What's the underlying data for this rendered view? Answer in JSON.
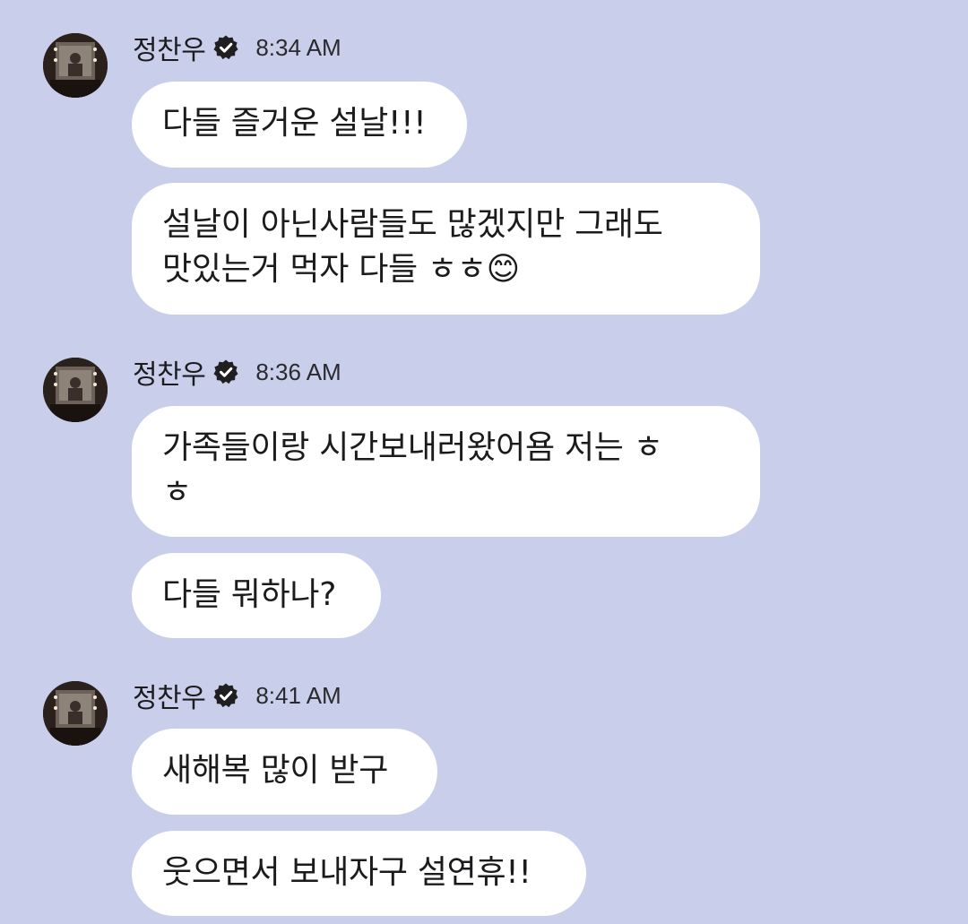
{
  "messages": [
    {
      "sender": "정찬우",
      "time": "8:34 AM",
      "bubbles": [
        "다들 즐거운 설날!!!",
        "설날이 아닌사람들도 많겠지만 그래도\n맛있는거 먹자 다들 ㅎㅎ😊"
      ]
    },
    {
      "sender": "정찬우",
      "time": "8:36 AM",
      "bubbles": [
        "가족들이랑 시간보내러왔어욤 저는 ㅎ\nㅎ",
        "다들 뭐하나?"
      ]
    },
    {
      "sender": "정찬우",
      "time": "8:41 AM",
      "bubbles": [
        "새해복 많이 받구",
        "웃으면서 보내자구 설연휴!!"
      ]
    }
  ],
  "icons": {
    "verified": "verified-badge-icon"
  },
  "colors": {
    "background": "#c9cfea",
    "bubble": "#ffffff",
    "text": "#1b1b1d"
  }
}
